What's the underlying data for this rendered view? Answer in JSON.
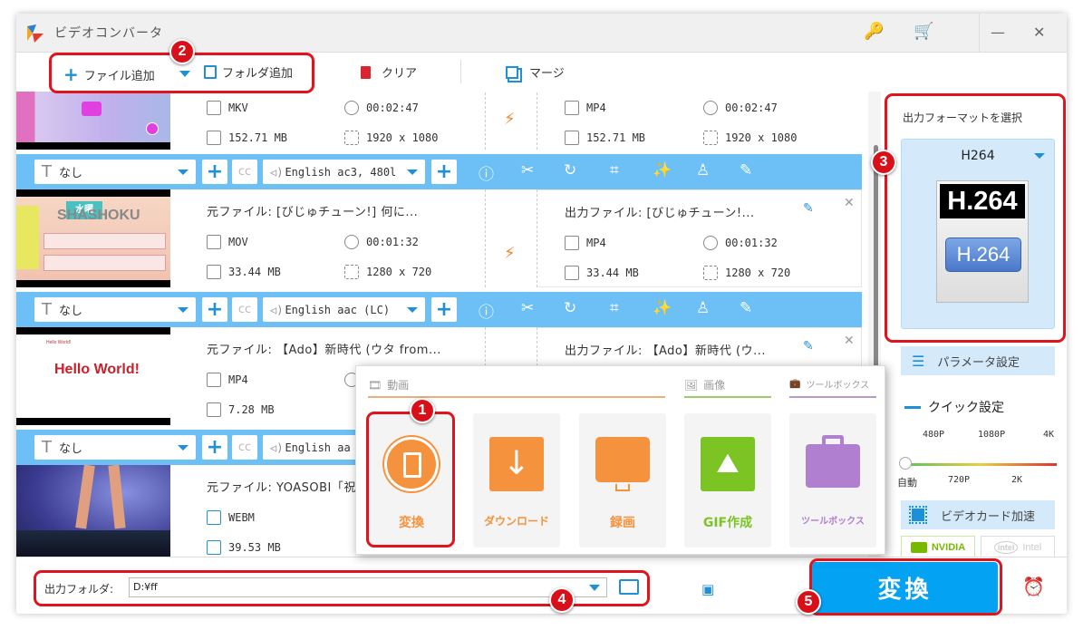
{
  "window": {
    "title": "ビデオコンバータ"
  },
  "titlebar": {
    "key_icon": "🔑",
    "cart_icon": "🛒",
    "minimize": "—",
    "close": "✕"
  },
  "toolbar": {
    "add_file": "ファイル追加",
    "add_folder": "フォルダ追加",
    "clear": "クリア",
    "merge": "マージ"
  },
  "files": [
    {
      "source_title": "",
      "source_format": "MKV",
      "source_duration": "00:02:47",
      "source_size": "152.71 MB",
      "source_resolution": "1920 x 1080",
      "output_title": "",
      "output_format": "MP4",
      "output_duration": "00:02:47",
      "output_size": "152.71 MB",
      "output_resolution": "1920 x 1080",
      "subtitle": "なし",
      "audio": "English ac3, 480l"
    },
    {
      "source_title": "元ファイル: [びじゅチューン!] 何に...",
      "source_format": "MOV",
      "source_duration": "00:01:32",
      "source_size": "33.44 MB",
      "source_resolution": "1280 x 720",
      "output_title": "出力ファイル: [びじゅチューン!...",
      "output_format": "MP4",
      "output_duration": "00:01:32",
      "output_size": "33.44 MB",
      "output_resolution": "1280 x 720",
      "subtitle": "なし",
      "audio": "English aac (LC)"
    },
    {
      "source_title": "元ファイル: 【Ado】新時代 (ウタ from...",
      "source_format": "MP4",
      "source_duration": "",
      "source_size": "7.28 MB",
      "source_resolution": "",
      "output_title": "出力ファイル: 【Ado】新時代 (ウ...",
      "thumb_text_small": "Hello World!",
      "thumb_text_big": "Hello World!",
      "subtitle": "なし",
      "audio": "English aa"
    },
    {
      "source_title": "元ファイル: YOASOBI「祝",
      "source_format": "WEBM",
      "source_size": "39.53 MB"
    }
  ],
  "popup": {
    "categories": {
      "video": "動画",
      "image": "画像",
      "toolbox": "ツールボックス"
    },
    "tiles": [
      {
        "label": "変換",
        "color": "#f5923e"
      },
      {
        "label": "ダウンロード",
        "color": "#f5923e"
      },
      {
        "label": "録画",
        "color": "#f5923e"
      },
      {
        "label": "GIF作成",
        "color": "#7cc424"
      },
      {
        "label": "ツールボックス",
        "color": "#b07fd0"
      }
    ]
  },
  "right_panel": {
    "format_label": "出力フォーマットを選択",
    "format_name": "H264",
    "format_icon_text": "H.264",
    "param_settings": "パラメータ設定",
    "quick_settings": "クイック設定",
    "slider_top_labels": [
      "480P",
      "1080P",
      "4K"
    ],
    "slider_bottom_labels": [
      "自動",
      "720P",
      "2K"
    ],
    "slider_value": "自動",
    "gpu_accel": "ビデオカード加速",
    "nvidia": "NVIDIA",
    "intel": "Intel"
  },
  "bottom": {
    "output_folder_label": "出力フォルダ:",
    "output_folder_value": "D:¥ff",
    "convert_button": "変換"
  },
  "annotations": [
    "1",
    "2",
    "3",
    "4",
    "5"
  ],
  "colors": {
    "accent": "#04a2f3",
    "bar": "#6cc0f5",
    "annotation": "#e0141e",
    "orange": "#f5923e"
  }
}
